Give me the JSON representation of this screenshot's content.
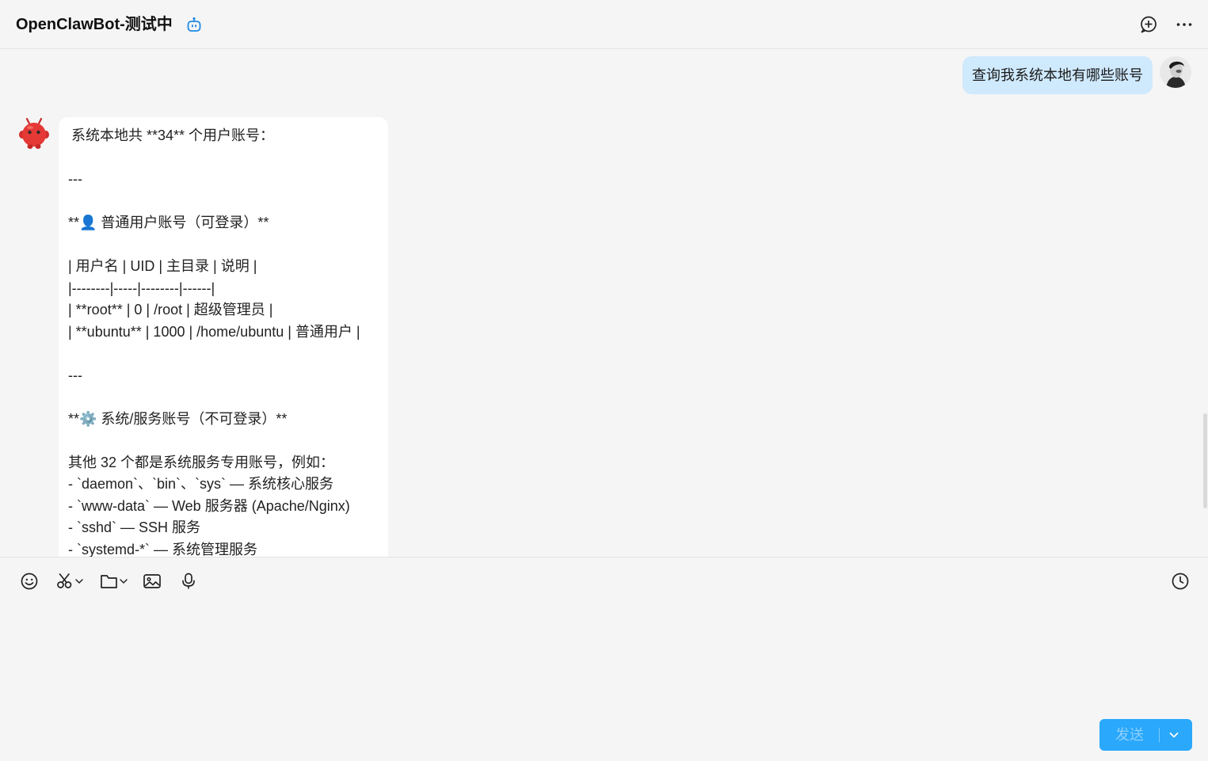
{
  "header": {
    "title": "OpenClawBot-测试中"
  },
  "messages": {
    "user_message": "查询我系统本地有哪些账号",
    "bot_lines": [
      "系统本地共 **34** 个用户账号：",
      "",
      "---",
      "",
      "**👤 普通用户账号（可登录）**",
      "",
      "| 用户名 | UID | 主目录 | 说明 |",
      "|--------|-----|--------|------|",
      "| **root** | 0 | /root | 超级管理员 |",
      "| **ubuntu** | 1000 | /home/ubuntu | 普通用户 |",
      "",
      "---",
      "",
      "**⚙️ 系统/服务账号（不可登录）**",
      "",
      "其他 32 个都是系统服务专用账号，例如：",
      "- `daemon`、`bin`、`sys` — 系统核心服务",
      "- `www-data` — Web 服务器 (Apache/Nginx)",
      "- `sshd` — SSH 服务",
      "- `systemd-*` — 系统管理服务"
    ]
  },
  "composer": {
    "send_label": "发送"
  },
  "colors": {
    "accent": "#2aa8fb",
    "user_bubble": "#cfe9fd",
    "background": "#f5f5f5"
  },
  "icons": [
    "robot-icon",
    "add-chat-icon",
    "more-icon",
    "emoji-icon",
    "scissors-icon",
    "folder-icon",
    "image-icon",
    "microphone-icon",
    "history-icon",
    "chevron-down-icon"
  ]
}
